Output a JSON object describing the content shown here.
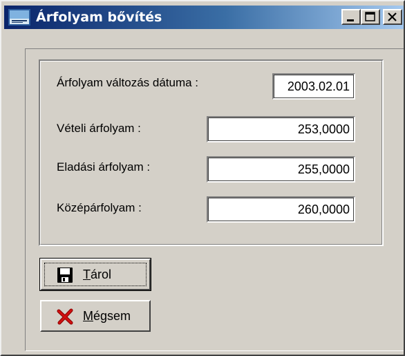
{
  "window": {
    "title": "Árfolyam bővítés",
    "app_icon": "app-logo-icon",
    "controls": {
      "minimize": "minimize-icon",
      "maximize": "maximize-icon",
      "close": "close-icon"
    }
  },
  "form": {
    "date_label": "Árfolyam változás dátuma :",
    "date_value": "2003.02.01",
    "buy_label": "Vételi árfolyam :",
    "buy_value": "253,0000",
    "sell_label": "Eladási árfolyam :",
    "sell_value": "255,0000",
    "mid_label": "Középárfolyam :",
    "mid_value": "260,0000"
  },
  "buttons": {
    "save": {
      "hotkey": "T",
      "rest": "árol",
      "icon": "floppy-disk-icon"
    },
    "cancel": {
      "hotkey": "M",
      "rest": "égsem",
      "icon": "red-x-icon"
    }
  },
  "colors": {
    "title_gradient_start": "#0a246a",
    "title_gradient_end": "#a6caf0",
    "face": "#d4d0c8"
  }
}
